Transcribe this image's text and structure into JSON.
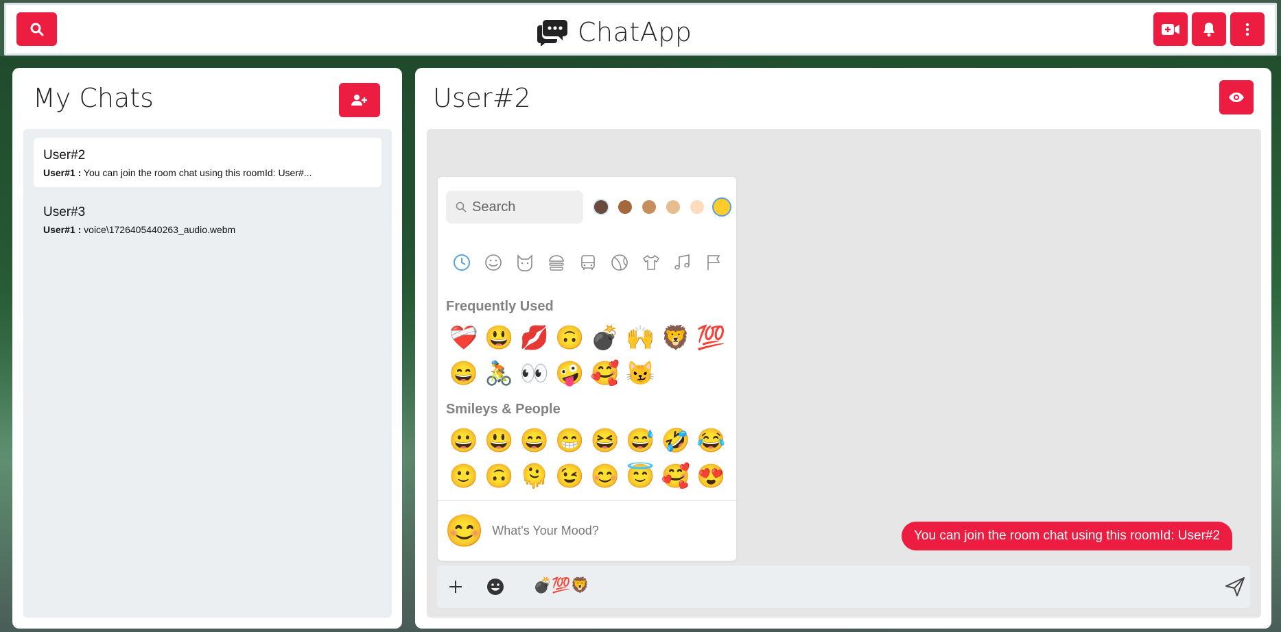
{
  "app": {
    "title": "ChatApp"
  },
  "sidebar": {
    "title": "My Chats",
    "chats": [
      {
        "name": "User#2",
        "sender": "User#1 :",
        "preview": "You can join the room chat using this roomId: User#..."
      },
      {
        "name": "User#3",
        "sender": "User#1 :",
        "preview": "voice\\1726405440263_audio.webm"
      }
    ]
  },
  "chat": {
    "title": "User#2",
    "messages": [
      {
        "text": "You can join the room chat using this roomId: User#2"
      }
    ],
    "input_emojis": "💣💯🦁"
  },
  "emoji_picker": {
    "search_placeholder": "Search",
    "skin_tones": [
      "#6b4a3e",
      "#a5683d",
      "#c68e5f",
      "#e7bd90",
      "#fcdcbc",
      "#fdcb2c"
    ],
    "categories": [
      "recent-icon",
      "smiley-icon",
      "cat-icon",
      "burger-icon",
      "bus-icon",
      "ball-icon",
      "shirt-icon",
      "music-icon",
      "flag-icon"
    ],
    "frequently_used_title": "Frequently Used",
    "frequently_used": [
      "❤️‍🩹",
      "😃",
      "💋",
      "🙃",
      "💣",
      "🙌",
      "🦁",
      "💯",
      "😄",
      "🚴",
      "👀",
      "🤪",
      "🥰",
      "😼"
    ],
    "smileys_title": "Smileys & People",
    "smileys": [
      "😀",
      "😃",
      "😄",
      "😁",
      "😆",
      "😅",
      "🤣",
      "😂",
      "🙂",
      "🙃",
      "🫠",
      "😉",
      "😊",
      "😇",
      "🥰",
      "😍"
    ],
    "preview_emoji": "😊",
    "preview_text": "What's Your Mood?"
  },
  "colors": {
    "accent": "#ec1d40"
  }
}
